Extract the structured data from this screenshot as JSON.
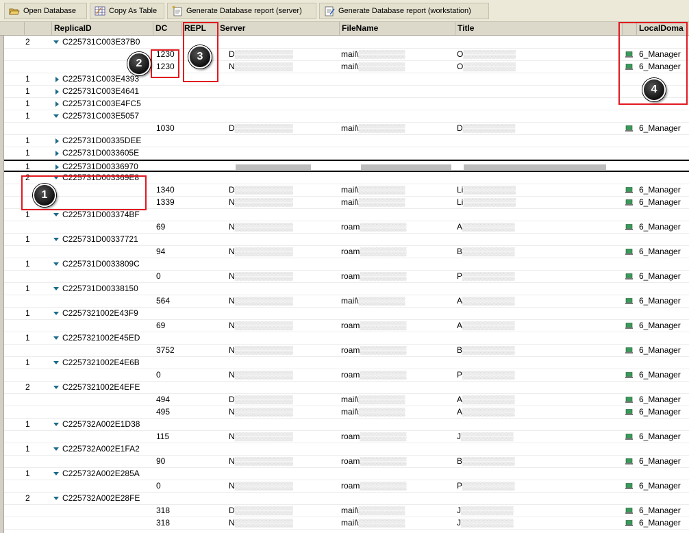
{
  "toolbar": {
    "open_db": "Open Database",
    "copy_table": "Copy As Table",
    "report_server": "Generate Database report (server)",
    "report_ws": "Generate Database report (workstation)"
  },
  "columns": {
    "replica": "ReplicaID",
    "dc": "DC",
    "repl": "REPL",
    "server": "Server",
    "file": "FileName",
    "title": "Title",
    "domain": "LocalDoma"
  },
  "rows": [
    {
      "count": "2",
      "replica": "C225731C003E37B0",
      "expanded": "down"
    },
    {
      "dc": "1230",
      "server": "D",
      "file": "mail\\",
      "title": "O",
      "domain": "6_Manager"
    },
    {
      "dc": "1230",
      "server": "N",
      "file": "mail\\",
      "title": "O",
      "domain": "6_Manager"
    },
    {
      "count": "1",
      "replica": "C225731C003E4393",
      "expanded": "right"
    },
    {
      "count": "1",
      "replica": "C225731C003E4641",
      "expanded": "right"
    },
    {
      "count": "1",
      "replica": "C225731C003E4FC5",
      "expanded": "right"
    },
    {
      "count": "1",
      "replica": "C225731C003E5057",
      "expanded": "down"
    },
    {
      "dc": "1030",
      "server": "D",
      "file": "mail\\",
      "title": "D",
      "domain": "6_Manager"
    },
    {
      "count": "1",
      "replica": "C225731D00335DEE",
      "expanded": "right"
    },
    {
      "count": "1",
      "replica": "C225731D0033605E",
      "expanded": "right"
    },
    {
      "count": "1",
      "replica": "C225731D00336970",
      "expanded": "right",
      "selected": "yes"
    },
    {
      "count": "2",
      "replica": "C225731D003369E8",
      "expanded": "down"
    },
    {
      "dc": "1340",
      "server": "D",
      "file": "mail\\",
      "title": "Li",
      "domain": "6_Manager"
    },
    {
      "dc": "1339",
      "server": "N",
      "file": "mail\\",
      "title": "Li",
      "domain": "6_Manager"
    },
    {
      "count": "1",
      "replica": "C225731D003374BF",
      "expanded": "down"
    },
    {
      "dc": "69",
      "server": "N",
      "file": "roam",
      "title": "A",
      "domain": "6_Manager"
    },
    {
      "count": "1",
      "replica": "C225731D00337721",
      "expanded": "down"
    },
    {
      "dc": "94",
      "server": "N",
      "file": "roam",
      "title": "B",
      "domain": "6_Manager"
    },
    {
      "count": "1",
      "replica": "C225731D0033809C",
      "expanded": "down"
    },
    {
      "dc": "0",
      "server": "N",
      "file": "roam",
      "title": "P",
      "domain": "6_Manager"
    },
    {
      "count": "1",
      "replica": "C225731D00338150",
      "expanded": "down"
    },
    {
      "dc": "564",
      "server": "N",
      "file": "mail\\",
      "title": "A",
      "domain": "6_Manager"
    },
    {
      "count": "1",
      "replica": "C2257321002E43F9",
      "expanded": "down"
    },
    {
      "dc": "69",
      "server": "N",
      "file": "roam",
      "title": "A",
      "domain": "6_Manager"
    },
    {
      "count": "1",
      "replica": "C2257321002E45ED",
      "expanded": "down"
    },
    {
      "dc": "3752",
      "server": "N",
      "file": "roam",
      "title": "B",
      "domain": "6_Manager"
    },
    {
      "count": "1",
      "replica": "C2257321002E4E6B",
      "expanded": "down"
    },
    {
      "dc": "0",
      "server": "N",
      "file": "roam",
      "title": "P",
      "domain": "6_Manager"
    },
    {
      "count": "2",
      "replica": "C2257321002E4EFE",
      "expanded": "down"
    },
    {
      "dc": "494",
      "server": "D",
      "file": "mail\\",
      "title": "A",
      "domain": "6_Manager"
    },
    {
      "dc": "495",
      "server": "N",
      "file": "mail\\",
      "title": "A",
      "domain": "6_Manager"
    },
    {
      "count": "1",
      "replica": "C225732A002E1D38",
      "expanded": "down"
    },
    {
      "dc": "115",
      "server": "N",
      "file": "roam",
      "title": "J",
      "domain": "6_Manager"
    },
    {
      "count": "1",
      "replica": "C225732A002E1FA2",
      "expanded": "down"
    },
    {
      "dc": "90",
      "server": "N",
      "file": "roam",
      "title": "B",
      "domain": "6_Manager"
    },
    {
      "count": "1",
      "replica": "C225732A002E285A",
      "expanded": "down"
    },
    {
      "dc": "0",
      "server": "N",
      "file": "roam",
      "title": "P",
      "domain": "6_Manager"
    },
    {
      "count": "2",
      "replica": "C225732A002E28FE",
      "expanded": "down"
    },
    {
      "dc": "318",
      "server": "D",
      "file": "mail\\",
      "title": "J",
      "domain": "6_Manager"
    },
    {
      "dc": "318",
      "server": "N",
      "file": "mail\\",
      "title": "J",
      "domain": "6_Manager"
    }
  ],
  "callouts": [
    "1",
    "2",
    "3",
    "4"
  ],
  "colors": {
    "accent": "#e0191f",
    "tree": "#1a6a8a",
    "header": "#dcd9cb"
  }
}
